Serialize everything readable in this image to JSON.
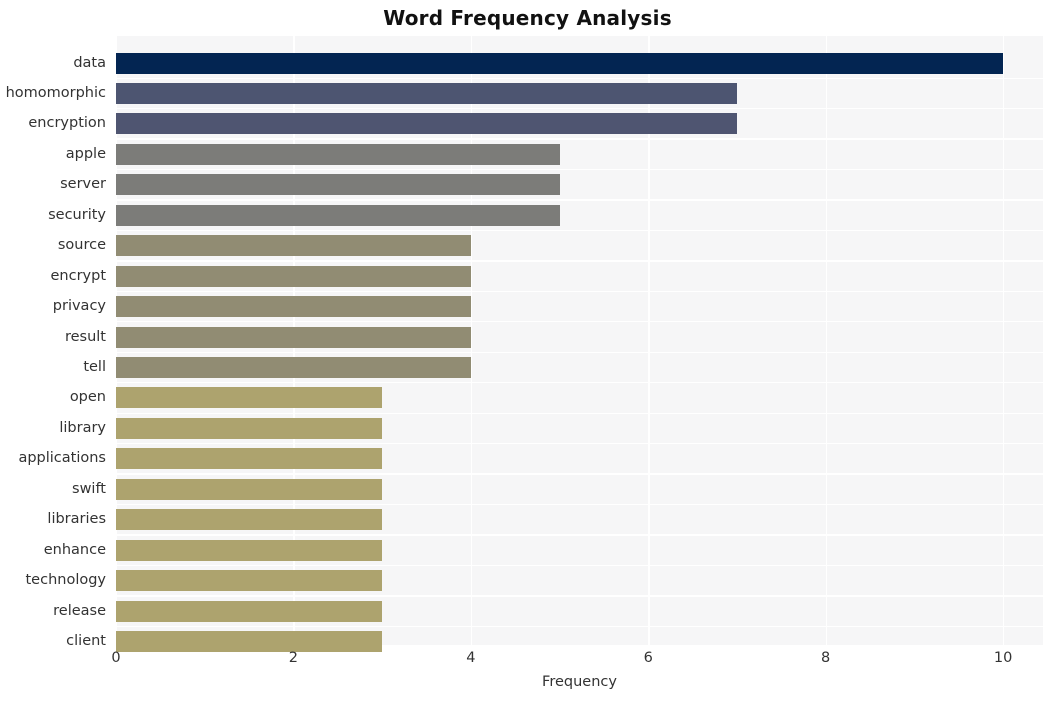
{
  "chart_data": {
    "type": "bar",
    "orientation": "horizontal",
    "title": "Word Frequency Analysis",
    "xlabel": "Frequency",
    "ylabel": "",
    "xlim": [
      0,
      10.45
    ],
    "xticks": [
      0,
      2,
      4,
      6,
      8,
      10
    ],
    "grid": true,
    "legend": null,
    "categories": [
      "data",
      "homomorphic",
      "encryption",
      "apple",
      "server",
      "security",
      "source",
      "encrypt",
      "privacy",
      "result",
      "tell",
      "open",
      "library",
      "applications",
      "swift",
      "libraries",
      "enhance",
      "technology",
      "release",
      "client"
    ],
    "values": [
      10,
      7,
      7,
      5,
      5,
      5,
      4,
      4,
      4,
      4,
      4,
      3,
      3,
      3,
      3,
      3,
      3,
      3,
      3,
      3
    ],
    "bar_colors": [
      "#032552",
      "#4d5571",
      "#4f5571",
      "#7c7c79",
      "#7c7c79",
      "#7c7c79",
      "#918c73",
      "#918c73",
      "#918c73",
      "#918c73",
      "#918c73",
      "#ada36e",
      "#ada36e",
      "#ada36e",
      "#ada36e",
      "#ada36e",
      "#ada36e",
      "#ada36e",
      "#ada36e",
      "#ada36e"
    ]
  },
  "style": {
    "figure_background": "#ffffff",
    "plot_background": "#f6f6f7",
    "grid_color": "#ffffff",
    "tick_label_color": "#333333",
    "title_color": "#111111"
  }
}
